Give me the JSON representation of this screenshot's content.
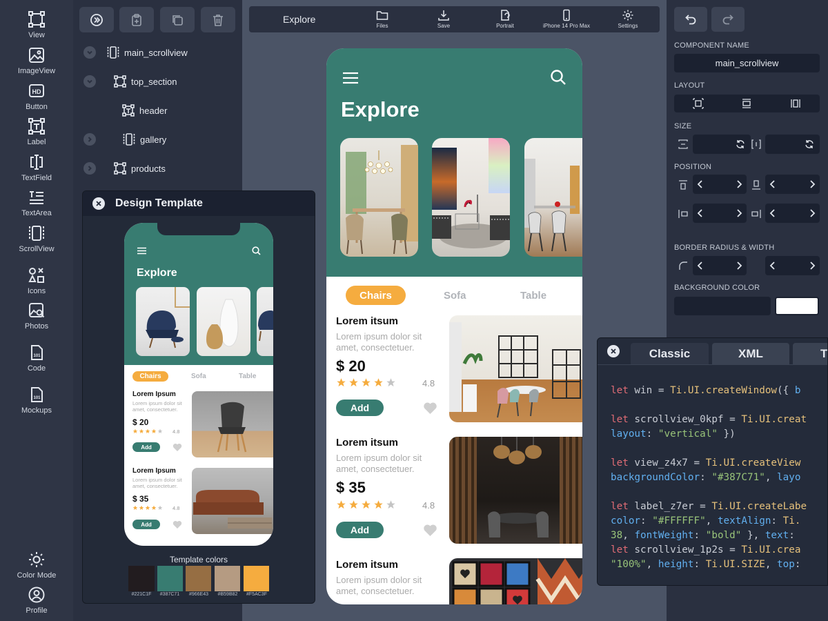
{
  "left_toolbar": {
    "items": [
      {
        "label": "View",
        "icon": "view-icon"
      },
      {
        "label": "ImageView",
        "icon": "image-icon"
      },
      {
        "label": "Button",
        "icon": "button-hd-icon"
      },
      {
        "label": "Label",
        "icon": "label-icon"
      },
      {
        "label": "TextField",
        "icon": "textfield-icon"
      },
      {
        "label": "TextArea",
        "icon": "textarea-icon"
      },
      {
        "label": "ScrollView",
        "icon": "scrollview-icon"
      },
      {
        "label": "Icons",
        "icon": "shapes-icon"
      },
      {
        "label": "Photos",
        "icon": "photo-search-icon"
      },
      {
        "label": "Code",
        "icon": "code-file-icon"
      },
      {
        "label": "Mockups",
        "icon": "mockup-file-icon"
      }
    ],
    "bottom": [
      {
        "label": "Color Mode",
        "icon": "sun-icon"
      },
      {
        "label": "Profile",
        "icon": "profile-icon"
      }
    ]
  },
  "tree": {
    "toolbar": [
      "collapse-icon",
      "paste-icon",
      "duplicate-icon",
      "trash-icon"
    ],
    "nodes": [
      {
        "label": "main_scrollview"
      },
      {
        "label": "top_section"
      },
      {
        "label": "header"
      },
      {
        "label": "gallery"
      },
      {
        "label": "products"
      }
    ]
  },
  "design_template": {
    "title": "Design Template",
    "header_title": "Explore",
    "tabs": [
      "Chairs",
      "Sofa",
      "Table"
    ],
    "products": [
      {
        "name": "Lorem Ipsum",
        "desc": "Lorem ipsum dolor sit amet, consectetuer.",
        "price": "$ 20",
        "rating": "4.8",
        "add": "Add"
      },
      {
        "name": "Lorem Ipsum",
        "desc": "Lorem ipsum dolor sit amet, consectetuer.",
        "price": "$ 35",
        "rating": "4.8",
        "add": "Add"
      }
    ],
    "colors_title": "Template colors",
    "colors": [
      {
        "hex": "#221C1F",
        "label": "#221C1F"
      },
      {
        "hex": "#387C71",
        "label": "#387C71"
      },
      {
        "hex": "#966E43",
        "label": "#966E43"
      },
      {
        "hex": "#B59B82",
        "label": "#B59B82"
      },
      {
        "hex": "#F5AC3F",
        "label": "#F5AC3F"
      }
    ]
  },
  "canvas_toolbar": {
    "title": "Explore",
    "items": [
      {
        "label": "Files",
        "icon": "folder-icon"
      },
      {
        "label": "Save",
        "icon": "download-icon"
      },
      {
        "label": "Portrait",
        "icon": "rotate-icon"
      },
      {
        "label": "iPhone 14 Pro Max",
        "icon": "phone-icon"
      },
      {
        "label": "Settings",
        "icon": "gear-icon"
      }
    ]
  },
  "preview": {
    "title": "Explore",
    "tabs": [
      "Chairs",
      "Sofa",
      "Table"
    ],
    "products": [
      {
        "name": "Lorem itsum",
        "desc": "Lorem ipsum dolor sit amet, consectetuer.",
        "price": "$ 20",
        "rating": "4.8",
        "add": "Add"
      },
      {
        "name": "Lorem itsum",
        "desc": "Lorem ipsum dolor sit amet, consectetuer.",
        "price": "$ 35",
        "rating": "4.8",
        "add": "Add"
      },
      {
        "name": "Lorem itsum",
        "desc": "Lorem ipsum dolor sit amet, consectetuer."
      }
    ]
  },
  "properties": {
    "component_name_label": "COMPONENT NAME",
    "component_name": "main_scrollview",
    "layout_label": "LAYOUT",
    "size_label": "SIZE",
    "position_label": "POSITION",
    "border_label": "BORDER RADIUS & WIDTH",
    "bg_label": "BACKGROUND COLOR",
    "bg_swatch": "#FFFFFF"
  },
  "code_panel": {
    "tabs": [
      "Classic",
      "XML",
      "T"
    ]
  },
  "theme": {
    "accent_green": "#387C71",
    "accent_orange": "#F5AC3F"
  }
}
